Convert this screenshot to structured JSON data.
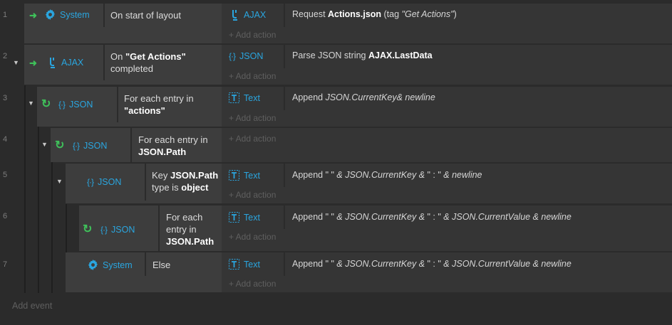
{
  "events": [
    {
      "line": "1",
      "condition_object": "System",
      "condition_object_icon": "gear-icon",
      "condition_text": "On start of layout",
      "actions": [
        {
          "object": "AJAX",
          "icon": "ajax-icon",
          "text_parts": [
            [
              "Request ",
              ""
            ],
            [
              "Actions.json",
              "b"
            ],
            [
              " (tag ",
              ""
            ],
            [
              "\"Get Actions\"",
              "i"
            ],
            [
              ")",
              ""
            ]
          ]
        }
      ]
    },
    {
      "line": "2",
      "condition_object": "AJAX",
      "condition_object_icon": "ajax-icon",
      "condition_text_parts": [
        [
          "On ",
          ""
        ],
        [
          "\"Get Actions\"",
          "b"
        ],
        [
          " completed",
          ""
        ]
      ],
      "actions": [
        {
          "object": "JSON",
          "icon": "json-icon",
          "text_parts": [
            [
              "Parse JSON string ",
              ""
            ],
            [
              "AJAX.LastData",
              "b"
            ]
          ]
        }
      ]
    },
    {
      "line": "3",
      "condition_object": "JSON",
      "condition_object_icon": "json-icon",
      "condition_text_parts": [
        [
          "For each entry in ",
          ""
        ],
        [
          "\"actions\"",
          "b"
        ]
      ],
      "actions": [
        {
          "object": "Text",
          "icon": "text-icon",
          "text_parts": [
            [
              "Append ",
              ""
            ],
            [
              "JSON.CurrentKey& newline",
              "i"
            ]
          ]
        }
      ]
    },
    {
      "line": "4",
      "condition_object": "JSON",
      "condition_object_icon": "json-icon",
      "condition_text_parts": [
        [
          "For each entry in ",
          ""
        ],
        [
          "JSON.Path",
          "b"
        ]
      ],
      "actions": []
    },
    {
      "line": "5",
      "condition_object": "JSON",
      "condition_object_icon": "json-icon",
      "condition_text_parts": [
        [
          "Key ",
          ""
        ],
        [
          "JSON.Path",
          "b"
        ],
        [
          " type is ",
          ""
        ],
        [
          "object",
          "b"
        ]
      ],
      "actions": [
        {
          "object": "Text",
          "icon": "text-icon",
          "text_parts": [
            [
              "Append \" \" ",
              ""
            ],
            [
              "& JSON.CurrentKey & ",
              "i"
            ],
            [
              "\" : \" ",
              ""
            ],
            [
              "& newline",
              "i"
            ]
          ]
        }
      ]
    },
    {
      "line": "6",
      "condition_object": "JSON",
      "condition_object_icon": "json-icon",
      "condition_text_parts": [
        [
          "For each entry in ",
          ""
        ],
        [
          "JSON.Path",
          "b"
        ]
      ],
      "actions": [
        {
          "object": "Text",
          "icon": "text-icon",
          "text_parts": [
            [
              "Append \" \" ",
              ""
            ],
            [
              "& JSON.CurrentKey & ",
              "i"
            ],
            [
              "\" : \" ",
              ""
            ],
            [
              "& JSON.CurrentValue & newline",
              "i"
            ]
          ]
        }
      ]
    },
    {
      "line": "7",
      "condition_object": "System",
      "condition_object_icon": "gear-icon",
      "condition_text": "Else",
      "actions": [
        {
          "object": "Text",
          "icon": "text-icon",
          "text_parts": [
            [
              "Append \" \" ",
              ""
            ],
            [
              "& JSON.CurrentKey & ",
              "i"
            ],
            [
              "\" : \" ",
              ""
            ],
            [
              "& JSON.CurrentValue & newline",
              "i"
            ]
          ]
        }
      ]
    }
  ],
  "add_action_label": "+ Add action",
  "add_event_label": "Add event",
  "colors": {
    "background": "#2b2b2b",
    "condition_block": "#3d3d3d",
    "action_block": "#353535",
    "object_blue": "#2aa6e0",
    "trigger_green": "#3fc05a"
  }
}
